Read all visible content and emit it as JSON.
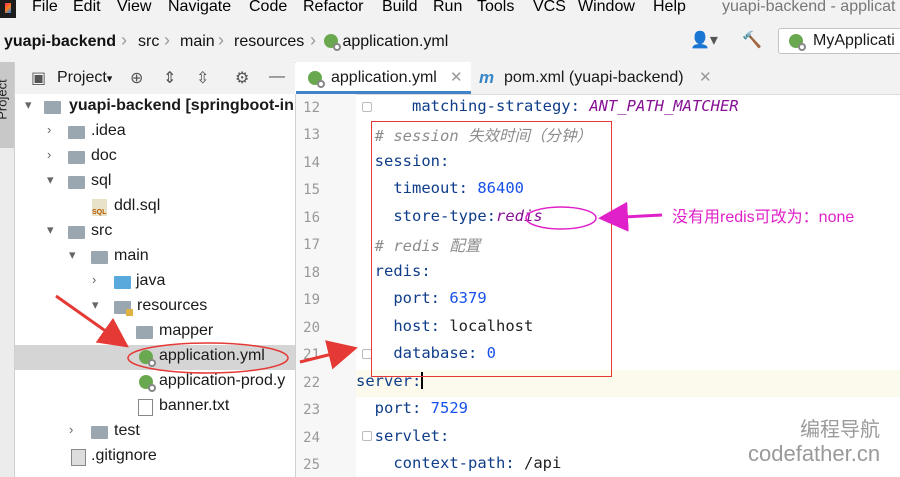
{
  "menubar": {
    "items": [
      "File",
      "Edit",
      "View",
      "Navigate",
      "Code",
      "Refactor",
      "Build",
      "Run",
      "Tools",
      "VCS",
      "Window",
      "Help"
    ],
    "window_title": "yuapi-backend - applicat"
  },
  "navbar": {
    "breadcrumbs": [
      "yuapi-backend",
      "src",
      "main",
      "resources",
      "application.yml"
    ],
    "run_config": "MyApplicati"
  },
  "side_tab": "Project",
  "project_panel": {
    "title": "Project"
  },
  "tree": [
    {
      "label": "yuapi-backend [springboot-ini",
      "icon": "folder-icon",
      "arrow": "▾"
    },
    {
      "label": ".idea",
      "icon": "folder-icon",
      "arrow": "›"
    },
    {
      "label": "doc",
      "icon": "folder-icon",
      "arrow": "›"
    },
    {
      "label": "sql",
      "icon": "folder-icon",
      "arrow": "▾"
    },
    {
      "label": "ddl.sql",
      "icon": "sql-file-icon",
      "arrow": ""
    },
    {
      "label": "src",
      "icon": "folder-icon",
      "arrow": "▾"
    },
    {
      "label": "main",
      "icon": "folder-icon",
      "arrow": "▾"
    },
    {
      "label": "java",
      "icon": "source-folder-icon",
      "arrow": "›"
    },
    {
      "label": "resources",
      "icon": "resources-folder-icon",
      "arrow": "▾"
    },
    {
      "label": "mapper",
      "icon": "folder-icon",
      "arrow": "›"
    },
    {
      "label": "application.yml",
      "icon": "yaml-file-icon",
      "arrow": ""
    },
    {
      "label": "application-prod.y",
      "icon": "yaml-file-icon",
      "arrow": ""
    },
    {
      "label": "banner.txt",
      "icon": "text-file-icon",
      "arrow": ""
    },
    {
      "label": "test",
      "icon": "folder-icon",
      "arrow": "›"
    },
    {
      "label": ".gitignore",
      "icon": "git-file-icon",
      "arrow": ""
    }
  ],
  "editor_tabs": [
    {
      "label": "application.yml",
      "icon": "yaml-file-icon"
    },
    {
      "label": "pom.xml (yuapi-backend)",
      "icon": "maven-icon"
    }
  ],
  "code": {
    "line_numbers": [
      "12",
      "13",
      "14",
      "15",
      "16",
      "17",
      "18",
      "19",
      "20",
      "21",
      "22",
      "23",
      "24",
      "25"
    ],
    "lines": [
      {
        "indent": "      ",
        "key": "matching-strategy",
        "sep": ": ",
        "value": "ANT_PATH_MATCHER",
        "kind": "enum"
      },
      {
        "indent": "  ",
        "comment": "# session 失效时间（分钟）"
      },
      {
        "indent": "  ",
        "key": "session",
        "sep": ":",
        "value": "",
        "kind": ""
      },
      {
        "indent": "    ",
        "key": "timeout",
        "sep": ": ",
        "value": "86400",
        "kind": "val"
      },
      {
        "indent": "    ",
        "key": "store-type",
        "sep": ":",
        "value": "redis",
        "kind": "enum"
      },
      {
        "indent": "  ",
        "comment": "# redis 配置"
      },
      {
        "indent": "  ",
        "key": "redis",
        "sep": ":",
        "value": "",
        "kind": ""
      },
      {
        "indent": "    ",
        "key": "port",
        "sep": ": ",
        "value": "6379",
        "kind": "val"
      },
      {
        "indent": "    ",
        "key": "host",
        "sep": ": ",
        "value": "localhost",
        "kind": "str"
      },
      {
        "indent": "    ",
        "key": "database",
        "sep": ": ",
        "value": "0",
        "kind": "val"
      },
      {
        "indent": "",
        "key": "server",
        "sep": ":",
        "value": "",
        "kind": "",
        "caret": true
      },
      {
        "indent": "  ",
        "key": "port",
        "sep": ": ",
        "value": "7529",
        "kind": "val"
      },
      {
        "indent": "  ",
        "key": "servlet",
        "sep": ":",
        "value": "",
        "kind": ""
      },
      {
        "indent": "    ",
        "key": "context-path",
        "sep": ": ",
        "value": "/api",
        "kind": "str"
      }
    ]
  },
  "annotation": {
    "text": "没有用redis可改为：none",
    "color": "#e020c8"
  },
  "watermark": {
    "line1": "编程导航",
    "line2": "codefather.cn"
  },
  "colors": {
    "highlight": "#e53935",
    "annotation": "#e020c8",
    "accent": "#4083c9"
  }
}
